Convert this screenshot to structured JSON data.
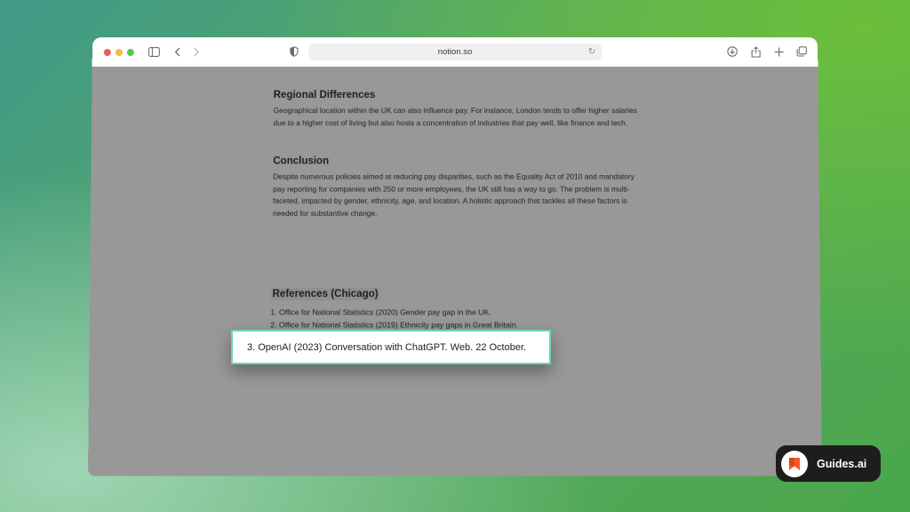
{
  "browser": {
    "address": "notion.so"
  },
  "document": {
    "sections": [
      {
        "heading": "Regional Differences",
        "body": "Geographical location within the UK can also influence pay. For instance, London tends to offer higher salaries due to a higher cost of living but also hosts a concentration of industries that pay well, like finance and tech."
      },
      {
        "heading": "Conclusion",
        "body": "Despite numerous policies aimed at reducing pay disparities, such as the Equality Act of 2010 and mandatory pay reporting for companies with 250 or more employees, the UK still has a way to go. The problem is multi-faceted, impacted by gender, ethnicity, age, and location. A holistic approach that tackles all these factors is needed for substantive change."
      }
    ],
    "references": {
      "heading": "References (Chicago)",
      "items": [
        "1. Office for National Statistics (2020) Gender pay gap in the UK.",
        "2. Office for National Statistics (2019) Ethnicity pay gaps in Great Britain."
      ]
    }
  },
  "callout": {
    "text": "3. OpenAI (2023) Conversation with ChatGPT. Web. 22 October."
  },
  "badge": {
    "label": "Guides.ai"
  },
  "colors": {
    "callout_border": "#6fd7a6",
    "page_dim": "#989898"
  },
  "icons": [
    "sidebar-icon",
    "back-icon",
    "forward-icon",
    "shield-icon",
    "reload-icon",
    "download-icon",
    "share-icon",
    "new-tab-icon",
    "tabs-overview-icon",
    "bookmark-icon"
  ]
}
